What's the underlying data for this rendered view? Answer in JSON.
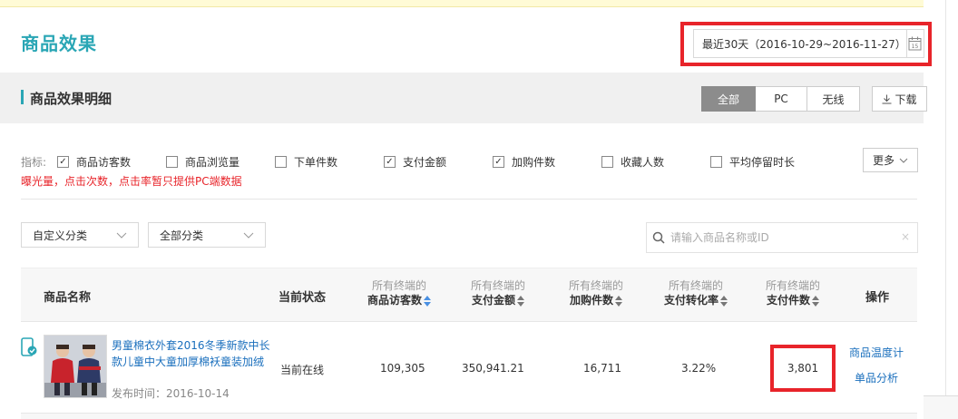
{
  "page_title": "商品效果",
  "date_range": {
    "label": "最近30天（2016-10-29~2016-11-27）",
    "calendar_day": "15"
  },
  "section": {
    "title": "商品效果明细",
    "terminal_tabs": [
      "全部",
      "PC",
      "无线"
    ],
    "active_tab": "全部",
    "download_label": "下载"
  },
  "metrics": {
    "label": "指标:",
    "options": [
      {
        "label": "商品访客数",
        "checked": true
      },
      {
        "label": "商品浏览量",
        "checked": false
      },
      {
        "label": "下单件数",
        "checked": false
      },
      {
        "label": "支付金额",
        "checked": true
      },
      {
        "label": "加购件数",
        "checked": true
      },
      {
        "label": "收藏人数",
        "checked": false
      },
      {
        "label": "平均停留时长",
        "checked": false
      }
    ],
    "more_label": "更多",
    "warning": "曝光量，点击次数，点击率暂只提供PC端数据"
  },
  "filters": {
    "category_custom": "自定义分类",
    "category_all": "全部分类",
    "search_placeholder": "请输入商品名称或ID",
    "clear_icon": "×"
  },
  "table": {
    "headers": {
      "product_name": "商品名称",
      "status": "当前状态",
      "metric_prefix": "所有终端的",
      "visitors": "商品访客数",
      "pay_amount": "支付金额",
      "cart_items": "加购件数",
      "conversion": "支付转化率",
      "pay_items": "支付件数",
      "action": "操作"
    },
    "rows": [
      {
        "product_name": "男童棉衣外套2016冬季新款中长款儿童中大童加厚棉袄童装加绒",
        "publish_time": "发布时间：2016-10-14",
        "status": "当前在线",
        "visitors": "109,305",
        "pay_amount": "350,941.21",
        "cart_items": "16,711",
        "conversion": "3.22%",
        "pay_items": "3,801",
        "actions": [
          "商品温度计",
          "单品分析"
        ]
      }
    ]
  },
  "colors": {
    "accent": "#2aa6b5",
    "highlight": "#e8242a",
    "link": "#1a6fbd",
    "sort_active": "#4a90e2"
  }
}
